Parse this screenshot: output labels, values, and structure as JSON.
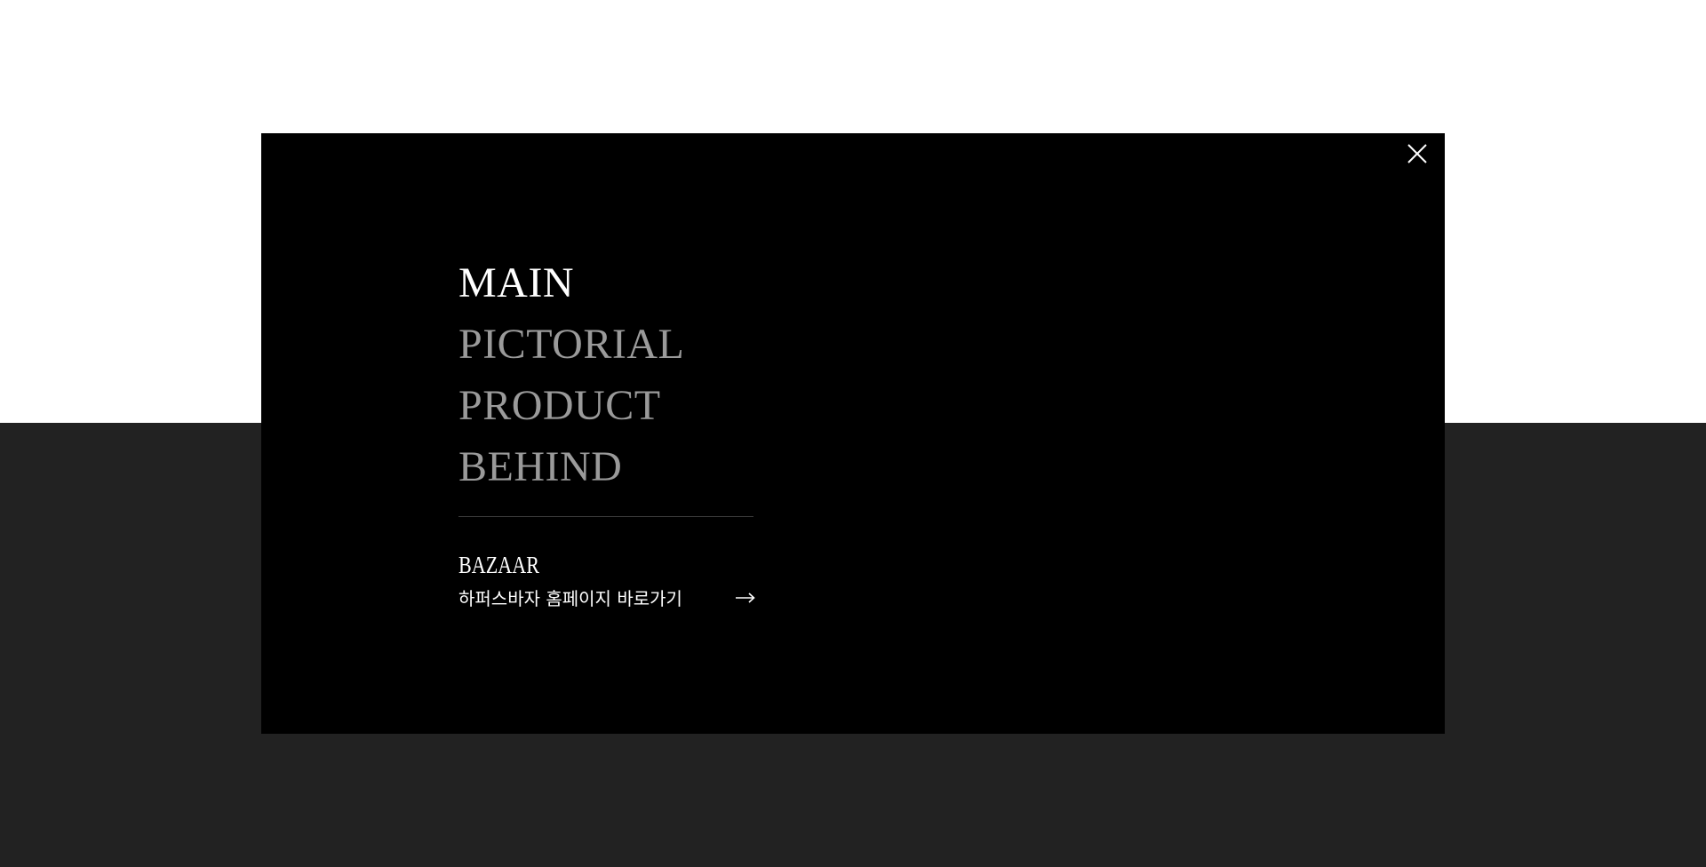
{
  "menu": {
    "items": [
      {
        "label": "MAIN",
        "active": true
      },
      {
        "label": "PICTORIAL",
        "active": false
      },
      {
        "label": "PRODUCT",
        "active": false
      },
      {
        "label": "BEHIND",
        "active": false
      }
    ]
  },
  "bazaar": {
    "logo": "BAZAAR",
    "link_text": "하퍼스바자 홈페이지 바로가기",
    "arrow_icon": "arrow-right-icon"
  },
  "close": {
    "icon": "close-icon"
  },
  "colors": {
    "modal_bg": "#000000",
    "page_top_bg": "#ffffff",
    "page_bottom_bg": "#222222",
    "active_text": "#ffffff",
    "inactive_text": "#9a9a9a",
    "divider": "#3a3a3a"
  }
}
